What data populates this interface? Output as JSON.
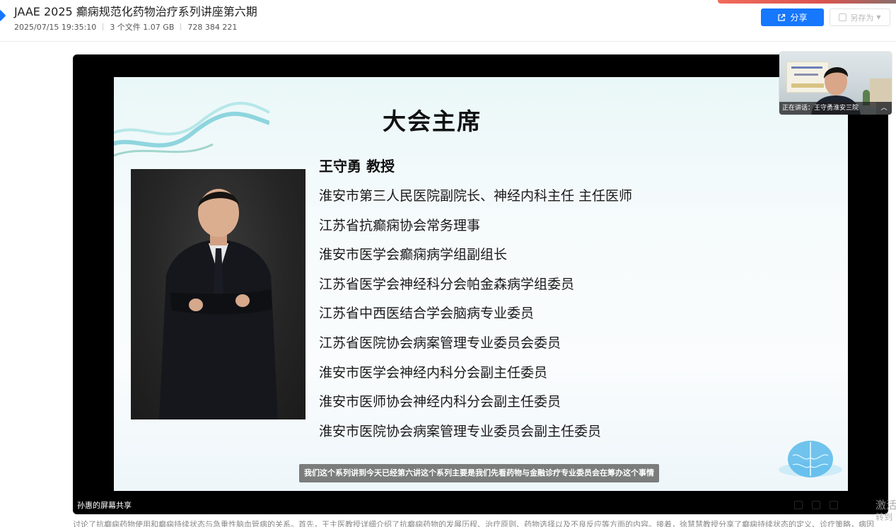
{
  "header": {
    "title": "JAAE 2025 癫痫规范化药物治疗系列讲座第六期",
    "date": "2025/07/15 19:35:10",
    "files": "3 个文件 1.07 GB",
    "id": "728 384 221",
    "share_label": "分享",
    "saveas_label": "另存为"
  },
  "slide": {
    "title": "大会主席",
    "name": "王守勇 教授",
    "positions": [
      "淮安市第三人民医院副院长、神经内科主任 主任医师",
      "江苏省抗癫痫协会常务理事",
      "淮安市医学会癫痫病学组副组长",
      "江苏省医学会神经科分会帕金森病学组委员",
      "江苏省中西医结合学会脑病专业委员",
      "江苏省医院协会病案管理专业委员会委员",
      "淮安市医学会神经内科分会副主任委员",
      "淮安市医师协会神经内科分会副主任委员",
      "淮安市医院协会病案管理专业委员会副主任委员"
    ]
  },
  "player": {
    "subtitle": "我们这个系列讲到今天已经第六讲这个系列主要是我们先看药物与金融诊疗专业委员会在筹办这个事情",
    "screen_share_label": "孙惠的屏幕共享"
  },
  "pip": {
    "speaking_label": "正在讲话：王守勇淮安三院"
  },
  "below_text": "讨论了抗癫痫药物使用和癫痫持续状态与急重性脑血管病的关系。首先，王主医教授详细介绍了抗癫痫药物的发展历程、治疗原则、药物选择以及不良反应等方面的内容。接着，徐慧慧教授分享了癫痫持续状态的定义、诊疗策略，病因",
  "watermark": {
    "line1": "激活",
    "line2": "转到"
  },
  "colors": {
    "accent": "#1677ff",
    "player_bg": "#000000"
  }
}
